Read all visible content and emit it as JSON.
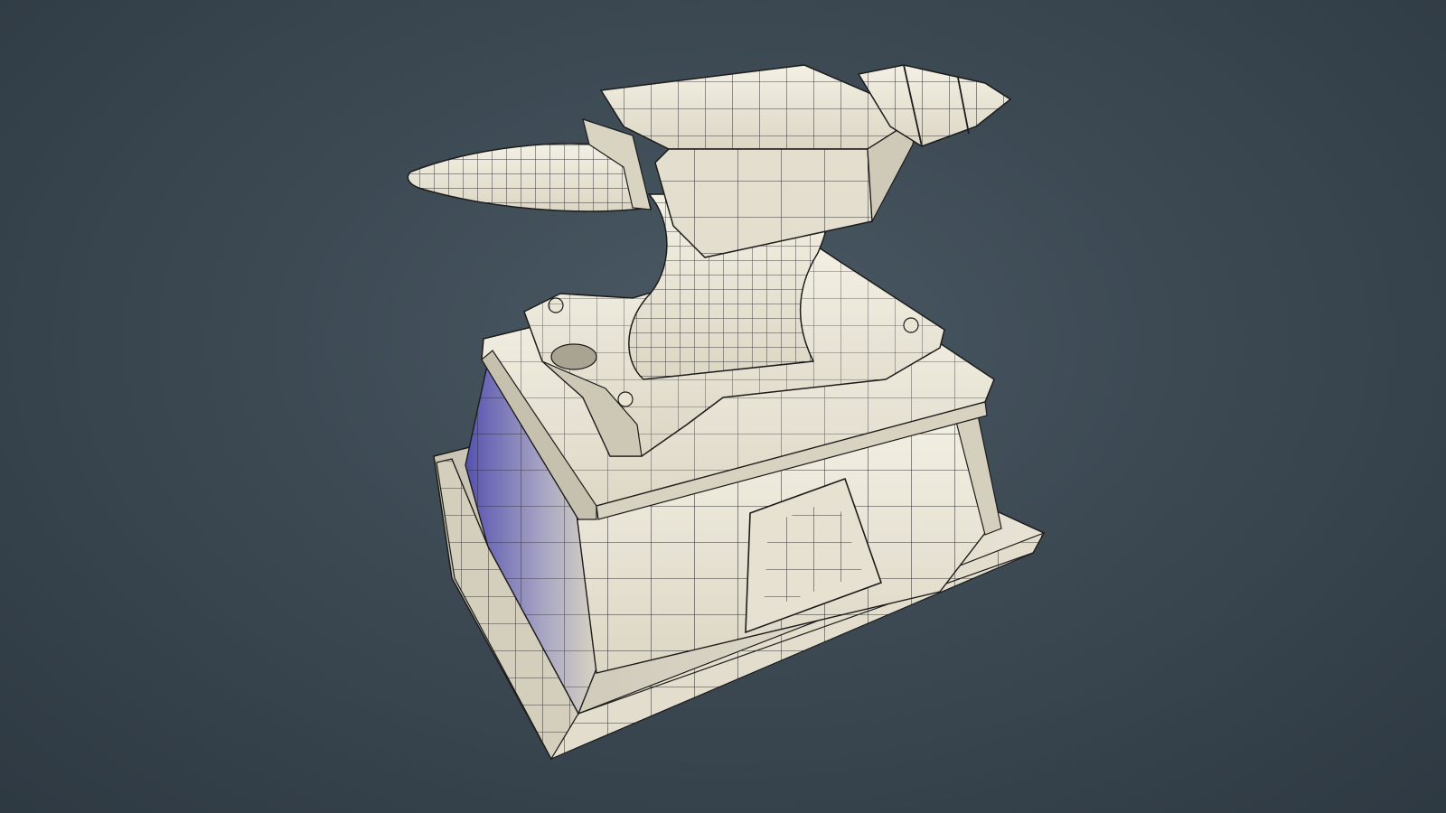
{
  "scene": {
    "subject": "anvil-on-pedestal-wireframe-render",
    "colors": {
      "background_center": "#4a5964",
      "background_edge": "#2e3942",
      "surface_light": "#ece8da",
      "surface_mid": "#d9d4c3",
      "surface_shadow": "#b7b1a0",
      "shadow_blue": "#4a47a8",
      "wire": "#1c1c1c"
    }
  }
}
